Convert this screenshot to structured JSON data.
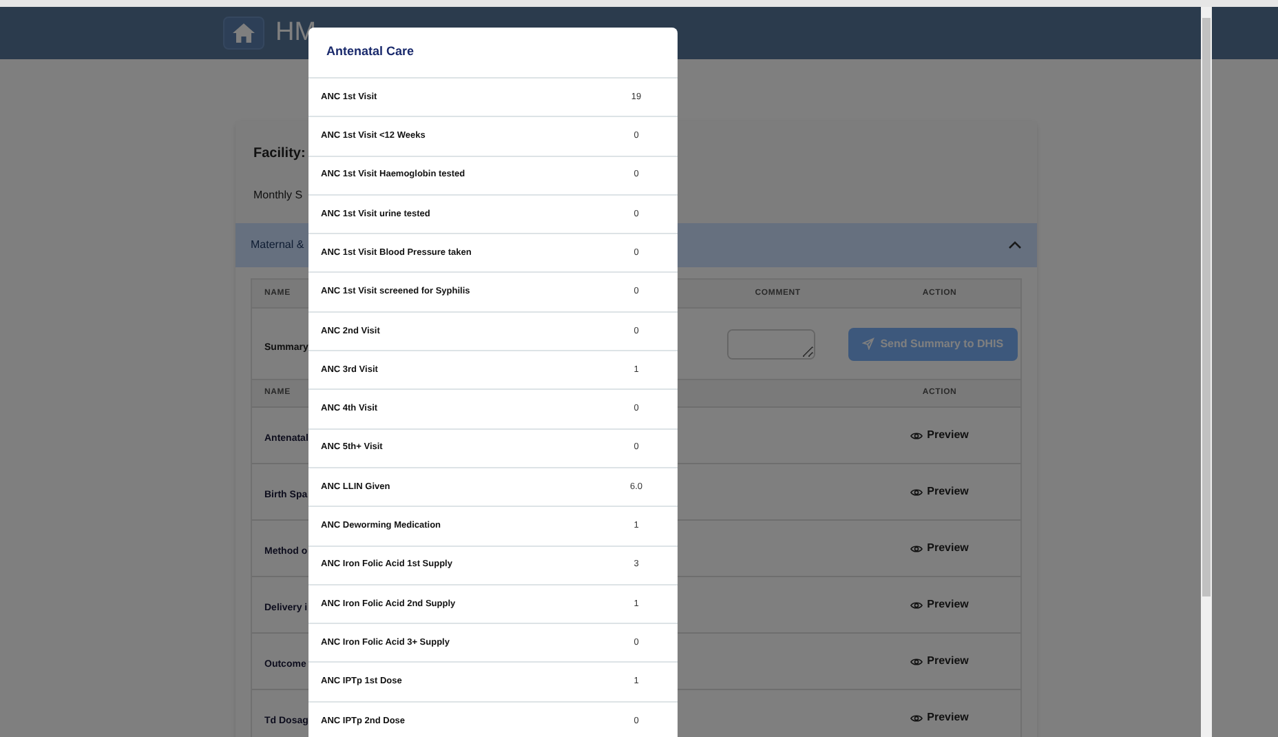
{
  "header": {
    "title": "HM"
  },
  "facility": {
    "label": "Facility:",
    "subtitle": "Monthly S"
  },
  "accordion": {
    "title": "Maternal &",
    "expanded": true
  },
  "summary_table": {
    "columns": [
      "NAME",
      "COMMENT",
      "ACTION"
    ],
    "row": {
      "name": "Summary",
      "button": "Send Summary to DHIS"
    }
  },
  "reports_table": {
    "columns": [
      "NAME",
      "ACTION"
    ],
    "rows": [
      {
        "name": "Antenatal",
        "action": "Preview"
      },
      {
        "name": "Birth Spa",
        "action": "Preview"
      },
      {
        "name": "Method o",
        "action": "Preview"
      },
      {
        "name": "Delivery i",
        "action": "Preview"
      },
      {
        "name": "Outcome",
        "action": "Preview"
      },
      {
        "name": "Td Dosag",
        "action": "Preview"
      }
    ]
  },
  "modal": {
    "title": "Antenatal Care",
    "rows": [
      {
        "name": "ANC 1st Visit",
        "value": "19"
      },
      {
        "name": "ANC 1st Visit <12 Weeks",
        "value": "0"
      },
      {
        "name": "ANC 1st Visit Haemoglobin tested",
        "value": "0"
      },
      {
        "name": "ANC 1st Visit urine tested",
        "value": "0"
      },
      {
        "name": "ANC 1st Visit Blood Pressure taken",
        "value": "0"
      },
      {
        "name": "ANC 1st Visit screened for Syphilis",
        "value": "0"
      },
      {
        "name": "ANC 2nd Visit",
        "value": "0"
      },
      {
        "name": "ANC 3rd Visit",
        "value": "1"
      },
      {
        "name": "ANC 4th Visit",
        "value": "0"
      },
      {
        "name": "ANC 5th+ Visit",
        "value": "0"
      },
      {
        "name": "ANC LLIN Given",
        "value": "6.0"
      },
      {
        "name": "ANC Deworming Medication",
        "value": "1"
      },
      {
        "name": "ANC Iron Folic Acid 1st Supply",
        "value": "3"
      },
      {
        "name": "ANC Iron Folic Acid 2nd Supply",
        "value": "1"
      },
      {
        "name": "ANC Iron Folic Acid 3+ Supply",
        "value": "0"
      },
      {
        "name": "ANC IPTp 1st Dose",
        "value": "1"
      },
      {
        "name": "ANC IPTp 2nd Dose",
        "value": "0"
      }
    ]
  }
}
